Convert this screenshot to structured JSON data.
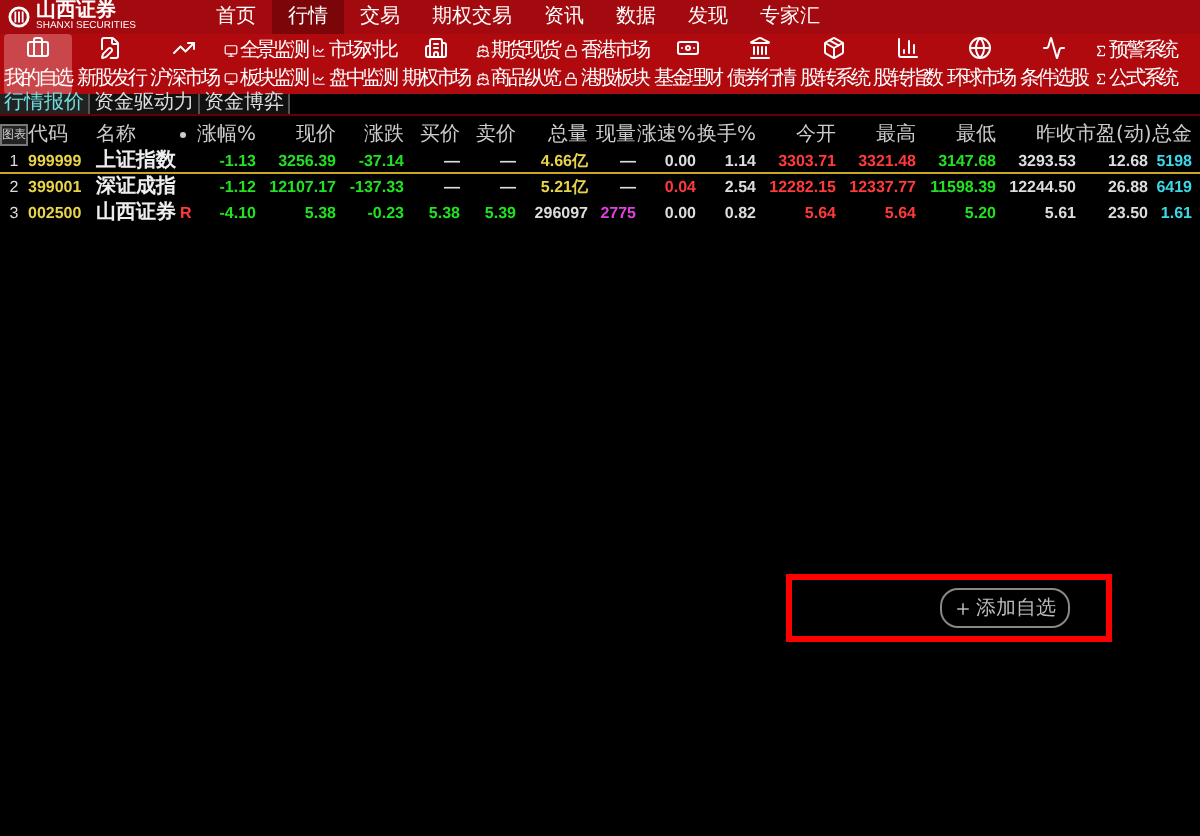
{
  "brand": {
    "name": "山西证券",
    "subtitle": "SHANXI SECURITIES"
  },
  "menu": [
    {
      "label": "首页",
      "selected": false
    },
    {
      "label": "行情",
      "selected": true
    },
    {
      "label": "交易",
      "selected": false
    },
    {
      "label": "期权交易",
      "selected": false
    },
    {
      "label": "资讯",
      "selected": false
    },
    {
      "label": "数据",
      "selected": false
    },
    {
      "label": "发现",
      "selected": false
    },
    {
      "label": "专家汇",
      "selected": false
    }
  ],
  "toolbar": [
    {
      "kind": "large",
      "label": "我的自选",
      "selected": true
    },
    {
      "kind": "large",
      "label": "新股发行",
      "selected": false
    },
    {
      "kind": "large",
      "label": "沪深市场",
      "selected": false
    },
    {
      "kind": "stack",
      "entries": [
        "全景监测",
        "板块监测"
      ]
    },
    {
      "kind": "stack",
      "entries": [
        "市场对比",
        "盘中监测"
      ]
    },
    {
      "kind": "large",
      "label": "期权市场",
      "selected": false
    },
    {
      "kind": "stack",
      "entries": [
        "期货现货",
        "商品纵览"
      ]
    },
    {
      "kind": "stack",
      "entries": [
        "香港市场",
        "港股板块"
      ]
    },
    {
      "kind": "large",
      "label": "基金理财",
      "selected": false
    },
    {
      "kind": "large",
      "label": "债券行情",
      "selected": false
    },
    {
      "kind": "large",
      "label": "股转系统",
      "selected": false
    },
    {
      "kind": "large",
      "label": "股转指数",
      "selected": false
    },
    {
      "kind": "large",
      "label": "环球市场",
      "selected": false
    },
    {
      "kind": "large",
      "label": "条件选股",
      "selected": false
    },
    {
      "kind": "stack",
      "entries": [
        "预警系统",
        "公式系统"
      ]
    }
  ],
  "tabs": [
    {
      "label": "行情报价",
      "selected": true
    },
    {
      "label": "资金驱动力",
      "selected": false
    },
    {
      "label": "资金博弈",
      "selected": false
    }
  ],
  "table": {
    "chart_button": "图表",
    "columns": [
      "代码",
      "名称",
      "涨幅%",
      "现价",
      "涨跌",
      "买价",
      "卖价",
      "总量",
      "现量",
      "涨速%",
      "换手%",
      "今开",
      "最高",
      "最低",
      "昨收",
      "市盈(动)",
      "总金"
    ],
    "rows": [
      {
        "index": "1",
        "selected": true,
        "cells": [
          {
            "text": "999999",
            "color": "#e8d44a"
          },
          {
            "text": "上证指数",
            "color": "#eeeeee"
          },
          {
            "text": "-1.13",
            "color": "#22e022"
          },
          {
            "text": "3256.39",
            "color": "#22e022"
          },
          {
            "text": "-37.14",
            "color": "#22e022"
          },
          {
            "text": "—",
            "color": "#dddddd"
          },
          {
            "text": "—",
            "color": "#dddddd"
          },
          {
            "text": "4.66亿",
            "color": "#e8d44a"
          },
          {
            "text": "—",
            "color": "#dddddd"
          },
          {
            "text": "0.00",
            "color": "#dddddd"
          },
          {
            "text": "1.14",
            "color": "#dddddd"
          },
          {
            "text": "3303.71",
            "color": "#ff3a3a"
          },
          {
            "text": "3321.48",
            "color": "#ff3a3a"
          },
          {
            "text": "3147.68",
            "color": "#22e022"
          },
          {
            "text": "3293.53",
            "color": "#dddddd"
          },
          {
            "text": "12.68",
            "color": "#dddddd"
          },
          {
            "text": "5198",
            "color": "#3ad8e8"
          }
        ]
      },
      {
        "index": "2",
        "selected": false,
        "cells": [
          {
            "text": "399001",
            "color": "#e8d44a"
          },
          {
            "text": "深证成指",
            "color": "#eeeeee"
          },
          {
            "text": "-1.12",
            "color": "#22e022"
          },
          {
            "text": "12107.17",
            "color": "#22e022"
          },
          {
            "text": "-137.33",
            "color": "#22e022"
          },
          {
            "text": "—",
            "color": "#dddddd"
          },
          {
            "text": "—",
            "color": "#dddddd"
          },
          {
            "text": "5.21亿",
            "color": "#e8d44a"
          },
          {
            "text": "—",
            "color": "#dddddd"
          },
          {
            "text": "0.04",
            "color": "#ff3a3a"
          },
          {
            "text": "2.54",
            "color": "#dddddd"
          },
          {
            "text": "12282.15",
            "color": "#ff3a3a"
          },
          {
            "text": "12337.77",
            "color": "#ff3a3a"
          },
          {
            "text": "11598.39",
            "color": "#22e022"
          },
          {
            "text": "12244.50",
            "color": "#dddddd"
          },
          {
            "text": "26.88",
            "color": "#dddddd"
          },
          {
            "text": "6419",
            "color": "#3ad8e8"
          }
        ]
      },
      {
        "index": "3",
        "selected": false,
        "mark": {
          "text": "R",
          "color": "#ff3a3a"
        },
        "cells": [
          {
            "text": "002500",
            "color": "#e8d44a"
          },
          {
            "text": "山西证券",
            "color": "#eeeeee"
          },
          {
            "text": "-4.10",
            "color": "#22e022"
          },
          {
            "text": "5.38",
            "color": "#22e022"
          },
          {
            "text": "-0.23",
            "color": "#22e022"
          },
          {
            "text": "5.38",
            "color": "#22e022"
          },
          {
            "text": "5.39",
            "color": "#22e022"
          },
          {
            "text": "296097",
            "color": "#dddddd"
          },
          {
            "text": "2775",
            "color": "#e040e0"
          },
          {
            "text": "0.00",
            "color": "#dddddd"
          },
          {
            "text": "0.82",
            "color": "#dddddd"
          },
          {
            "text": "5.64",
            "color": "#ff3a3a"
          },
          {
            "text": "5.64",
            "color": "#ff3a3a"
          },
          {
            "text": "5.20",
            "color": "#22e022"
          },
          {
            "text": "5.61",
            "color": "#dddddd"
          },
          {
            "text": "23.50",
            "color": "#dddddd"
          },
          {
            "text": "1.61",
            "color": "#3ad8e8"
          }
        ]
      }
    ]
  },
  "add_button": {
    "label": "添加自选",
    "highlighted": true
  }
}
